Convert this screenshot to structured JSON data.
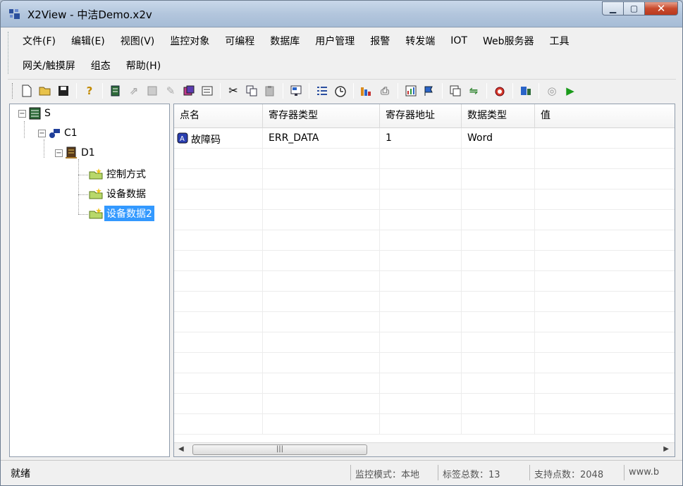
{
  "window": {
    "title": "X2View - 中洁Demo.x2v"
  },
  "menu": {
    "row1": [
      "文件(F)",
      "编辑(E)",
      "视图(V)",
      "监控对象",
      "可编程",
      "数据库",
      "用户管理",
      "报警",
      "转发端",
      "IOT",
      "Web服务器",
      "工具"
    ],
    "row2": [
      "网关/触摸屏",
      "组态",
      "帮助(H)"
    ]
  },
  "tree": {
    "root": "S",
    "channel": "C1",
    "device": "D1",
    "groups": [
      "控制方式",
      "设备数据",
      "设备数据2"
    ]
  },
  "grid": {
    "columns": [
      "点名",
      "寄存器类型",
      "寄存器地址",
      "数据类型",
      "值"
    ],
    "rows": [
      {
        "name": "故障码",
        "reg_type": "ERR_DATA",
        "reg_addr": "1",
        "data_type": "Word",
        "value": ""
      }
    ]
  },
  "statusbar": {
    "ready": "就绪",
    "monitor_mode": "监控模式：本地",
    "tag_count": "标签总数：13",
    "support_points": "支持点数：2048",
    "url": "www.b"
  }
}
